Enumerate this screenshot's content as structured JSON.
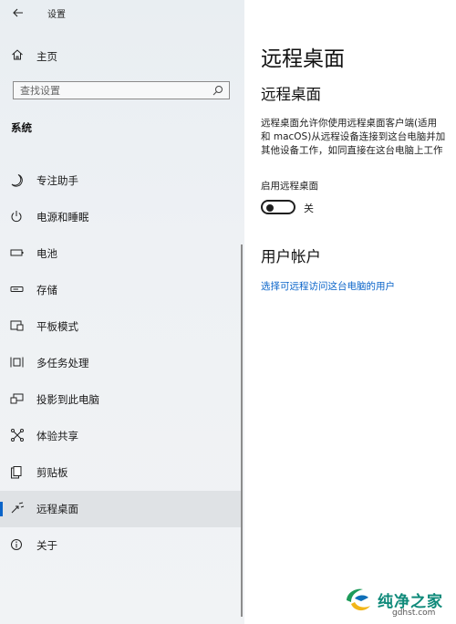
{
  "window": {
    "title": "设置"
  },
  "sidebar": {
    "home_label": "主页",
    "search_placeholder": "查找设置",
    "section_title": "系统",
    "items": [
      {
        "label": "专注助手",
        "icon": "moon-icon"
      },
      {
        "label": "电源和睡眠",
        "icon": "power-icon"
      },
      {
        "label": "电池",
        "icon": "battery-icon"
      },
      {
        "label": "存储",
        "icon": "storage-icon"
      },
      {
        "label": "平板模式",
        "icon": "tablet-mode-icon"
      },
      {
        "label": "多任务处理",
        "icon": "multitasking-icon"
      },
      {
        "label": "投影到此电脑",
        "icon": "project-icon"
      },
      {
        "label": "体验共享",
        "icon": "shared-experiences-icon"
      },
      {
        "label": "剪贴板",
        "icon": "clipboard-icon"
      },
      {
        "label": "远程桌面",
        "icon": "remote-desktop-icon",
        "selected": true
      },
      {
        "label": "关于",
        "icon": "info-icon"
      }
    ]
  },
  "main": {
    "page_title": "远程桌面",
    "subtitle": "远程桌面",
    "description_lines": [
      "远程桌面允许你使用远程桌面客户端(适用",
      "和 macOS)从远程设备连接到这台电脑并加",
      "其他设备工作，如同直接在这台电脑上工作"
    ],
    "toggle_label": "启用远程桌面",
    "toggle_state": "关",
    "toggle_on": false,
    "accounts_heading": "用户帐户",
    "accounts_link": "选择可远程访问这台电脑的用户"
  },
  "watermark": {
    "brand": "纯净之家",
    "url": "gdhst.com"
  },
  "colors": {
    "accent": "#0a64c9",
    "sidebar_bg": "#eef1f4",
    "link": "#0a64c9"
  }
}
